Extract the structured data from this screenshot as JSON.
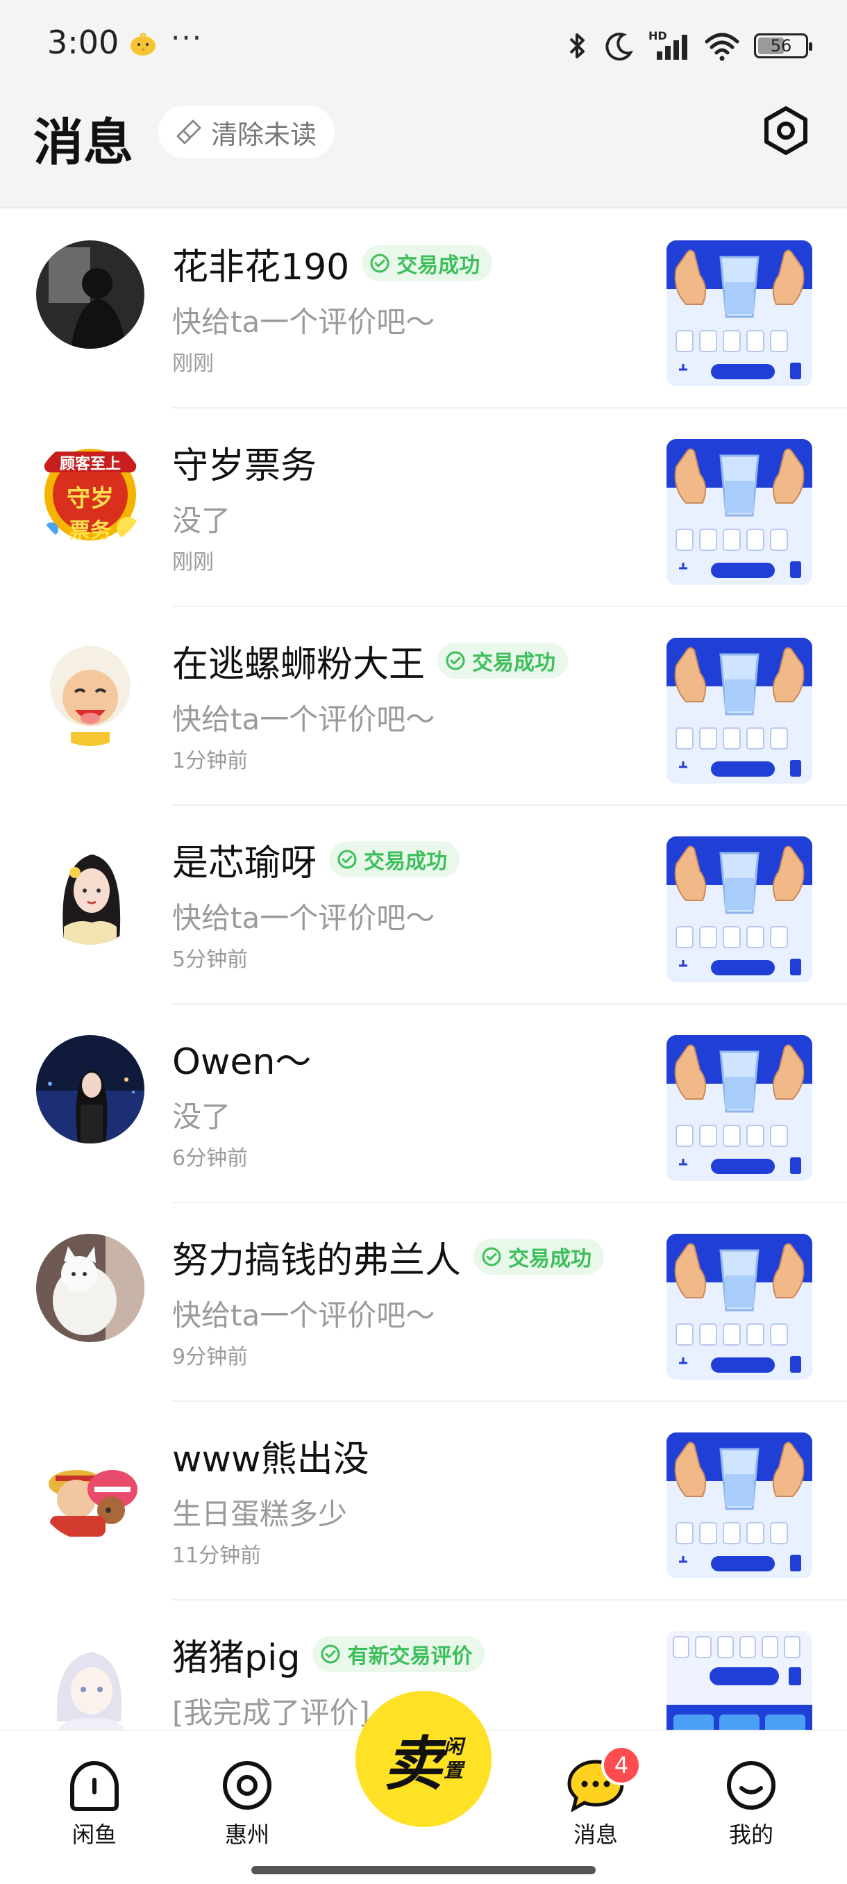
{
  "status_bar": {
    "time": "3:00",
    "dots": "···",
    "battery": "56",
    "battery_level": 0.56,
    "network_label": "HD"
  },
  "header": {
    "title": "消息",
    "clear_unread_label": "清除未读",
    "settings_icon": "settings-icon"
  },
  "conversations": [
    {
      "name": "花非花190",
      "badge": "交易成功",
      "message": "快给ta一个评价吧～",
      "time": "刚刚",
      "avatar": "dark-portrait"
    },
    {
      "name": "守岁票务",
      "badge": "",
      "message": "没了",
      "time": "刚刚",
      "avatar": "ticket-shop-logo",
      "avatar_text": "顾客至上",
      "avatar_text2": "守岁",
      "avatar_text3": "票务"
    },
    {
      "name": "在逃螺蛳粉大王",
      "badge": "交易成功",
      "message": "快给ta一个评价吧～",
      "time": "1分钟前",
      "avatar": "cartoon-sheep"
    },
    {
      "name": "是芯瑜呀",
      "badge": "交易成功",
      "message": "快给ta一个评价吧～",
      "time": "5分钟前",
      "avatar": "anime-girl"
    },
    {
      "name": "Owen～",
      "badge": "",
      "message": "没了",
      "time": "6分钟前",
      "avatar": "night-portrait"
    },
    {
      "name": "努力搞钱的弗兰人",
      "badge": "交易成功",
      "message": "快给ta一个评价吧～",
      "time": "9分钟前",
      "avatar": "white-cat"
    },
    {
      "name": "www熊出没",
      "badge": "",
      "message": "生日蛋糕多少",
      "time": "11分钟前",
      "avatar": "cartoon-pirates"
    },
    {
      "name": "猪猪pig",
      "badge": "有新交易评价",
      "message": "[我完成了评价]",
      "time": "",
      "avatar": "white-hair-anime"
    }
  ],
  "bottom_nav": {
    "items": [
      {
        "label": "闲鱼",
        "icon": "fish-home-icon"
      },
      {
        "label": "惠州",
        "icon": "location-icon"
      },
      {
        "label": "消息",
        "icon": "chat-bubble-icon",
        "badge": "4"
      },
      {
        "label": "我的",
        "icon": "smile-profile-icon"
      }
    ],
    "sell": {
      "main": "卖",
      "sub1": "闲",
      "sub2": "置"
    }
  },
  "colors": {
    "accent_yellow": "#ffe226",
    "success_green": "#3cbf5b",
    "badge_red": "#ff4d4f",
    "thumb_blue": "#1f3fd6"
  }
}
